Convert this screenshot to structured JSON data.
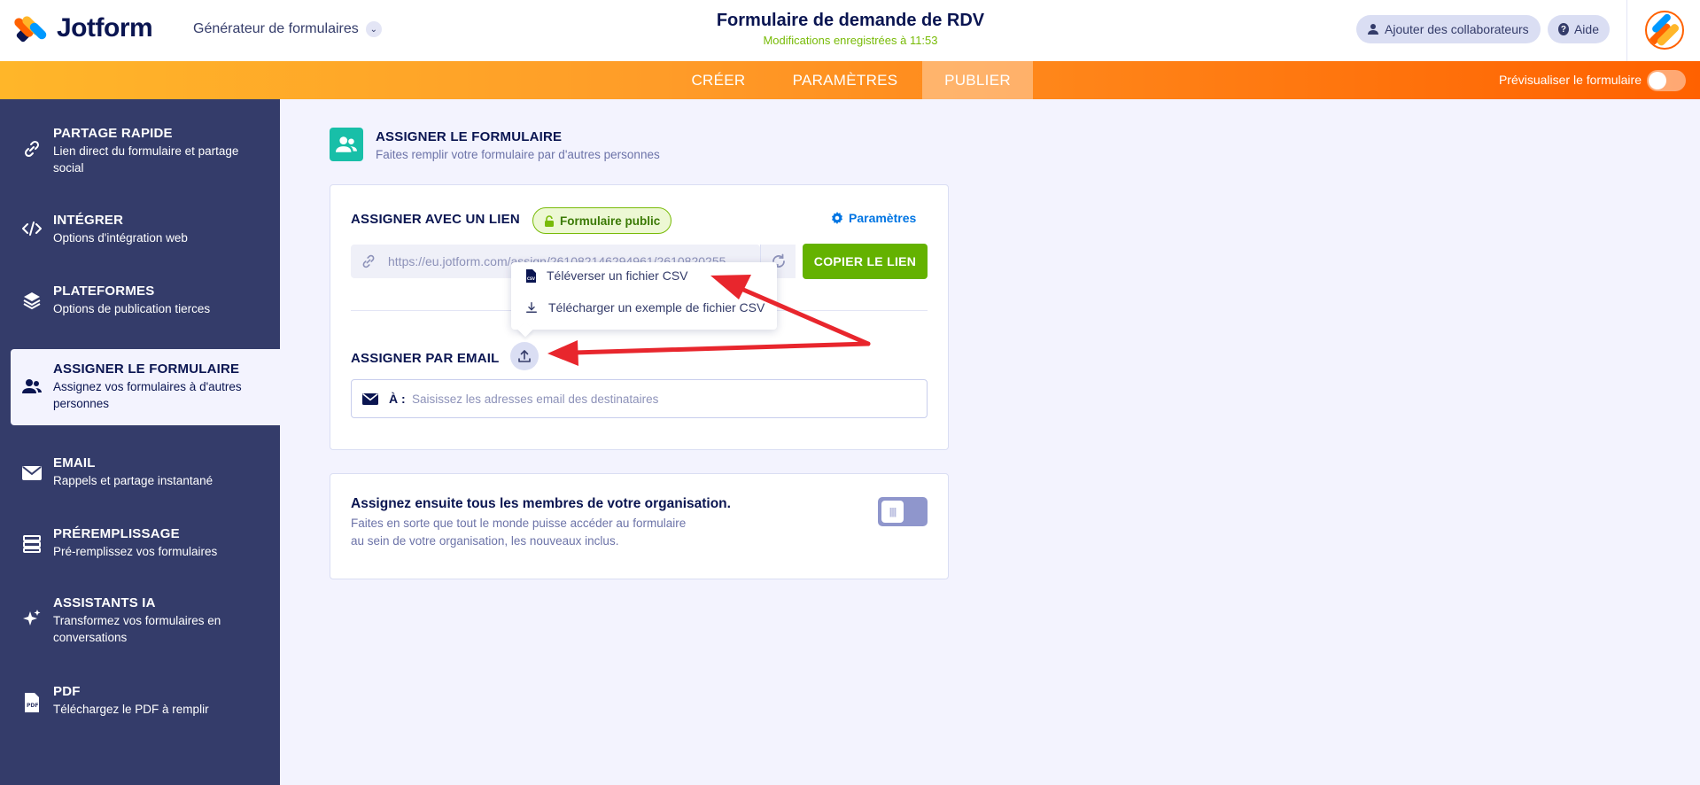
{
  "header": {
    "logo_text": "Jotform",
    "builder_label": "Générateur de formulaires",
    "form_title": "Formulaire de demande de RDV",
    "saved_status": "Modifications enregistrées à 11:53",
    "collaborators_label": "Ajouter des collaborateurs",
    "help_label": "Aide"
  },
  "nav": {
    "tabs": [
      {
        "label": "CRÉER",
        "active": false
      },
      {
        "label": "PARAMÈTRES",
        "active": false
      },
      {
        "label": "PUBLIER",
        "active": true
      }
    ],
    "preview_label": "Prévisualiser le formulaire",
    "preview_enabled": false
  },
  "sidebar": {
    "items": [
      {
        "title": "PARTAGE RAPIDE",
        "sub": "Lien direct du formulaire et partage social",
        "icon": "link-icon",
        "active": false
      },
      {
        "title": "INTÉGRER",
        "sub": "Options d'intégration web",
        "icon": "code-icon",
        "active": false
      },
      {
        "title": "PLATEFORMES",
        "sub": "Options de publication tierces",
        "icon": "layers-icon",
        "active": false
      },
      {
        "title": "ASSIGNER LE FORMULAIRE",
        "sub": "Assignez vos formulaires à d'autres personnes",
        "icon": "users-icon",
        "active": true
      },
      {
        "title": "EMAIL",
        "sub": "Rappels et partage instantané",
        "icon": "envelope-icon",
        "active": false
      },
      {
        "title": "PRÉREMPLISSAGE",
        "sub": "Pré-remplissez vos formulaires",
        "icon": "prefill-icon",
        "active": false
      },
      {
        "title": "ASSISTANTS IA",
        "sub": "Transformez vos formulaires en conversations",
        "icon": "sparkle-icon",
        "active": false
      },
      {
        "title": "PDF",
        "sub": "Téléchargez le PDF à remplir",
        "icon": "pdf-icon",
        "active": false
      }
    ]
  },
  "main": {
    "section_title": "ASSIGNER LE FORMULAIRE",
    "section_sub": "Faites remplir votre formulaire par d'autres personnes",
    "link_card": {
      "assign_link_label": "ASSIGNER AVEC UN LIEN",
      "public_badge": "Formulaire public",
      "settings_link": "Paramètres",
      "url": "https://eu.jotform.com/assign/261082146294961/2610820255",
      "copy_button": "COPIER LE LIEN",
      "assign_email_label": "ASSIGNER PAR EMAIL",
      "email_to_label": "À :",
      "email_placeholder": "Saisissez les adresses email des destinataires"
    },
    "org_card": {
      "title": "Assignez ensuite tous les membres de votre organisation.",
      "desc": "Faites en sorte que tout le monde puisse accéder au formulaire au sein de votre organisation, les nouveaux inclus.",
      "enabled": false
    },
    "csv_menu": {
      "items": [
        {
          "label": "Téléverser un fichier CSV",
          "icon": "csv-file-icon"
        },
        {
          "label": "Télécharger un exemple de fichier CSV",
          "icon": "download-icon"
        }
      ]
    }
  },
  "colors": {
    "brand_orange": "#ff6100",
    "accent_yellow": "#ffb629",
    "sidebar_bg": "#343c6a",
    "copy_green": "#64b200",
    "teal": "#18bfa8",
    "annotation_red": "#e8262d"
  }
}
